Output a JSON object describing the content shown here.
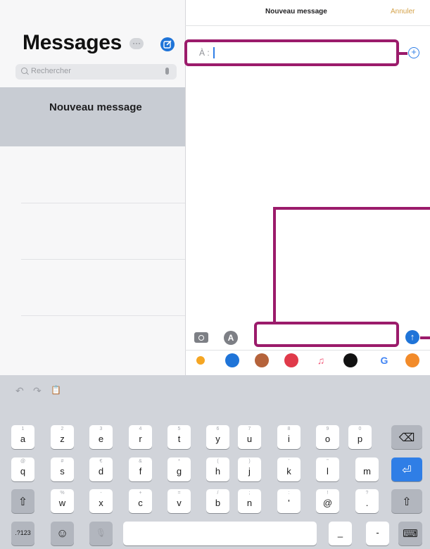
{
  "sidebar": {
    "title": "Messages",
    "more_label": "···",
    "search_placeholder": "Rechercher",
    "selected_conversation": "Nouveau message"
  },
  "header": {
    "title": "Nouveau message",
    "cancel_label": "Annuler"
  },
  "recipient": {
    "label": "À :",
    "add_label": "+"
  },
  "composer": {
    "send_label": "↑",
    "appstore_label": "A",
    "camera_icon": "camera-icon"
  },
  "app_drawer": {
    "apps": [
      {
        "name": "photos-app-icon",
        "color": "#f5a623"
      },
      {
        "name": "appstore-app-icon",
        "color": "#1f74d8"
      },
      {
        "name": "memoji-app-icon",
        "color": "#b5633b"
      },
      {
        "name": "images-search-app-icon",
        "color": "#e03a4a"
      },
      {
        "name": "music-app-icon",
        "color": "#f25a7a"
      },
      {
        "name": "digital-touch-app-icon",
        "color": "#111111"
      },
      {
        "name": "google-app-icon",
        "color": "#4285f4"
      },
      {
        "name": "animoji-app-icon",
        "color": "#f28b2a"
      }
    ],
    "music_glyph": "♫",
    "google_glyph": "G"
  },
  "keyboard": {
    "row1": [
      {
        "hint": "1",
        "label": "a"
      },
      {
        "hint": "2",
        "label": "z"
      },
      {
        "hint": "3",
        "label": "e"
      },
      {
        "hint": "4",
        "label": "r"
      },
      {
        "hint": "5",
        "label": "t"
      },
      {
        "hint": "6",
        "label": "y"
      },
      {
        "hint": "7",
        "label": "u"
      },
      {
        "hint": "8",
        "label": "i"
      },
      {
        "hint": "9",
        "label": "o"
      },
      {
        "hint": "0",
        "label": "p"
      }
    ],
    "row2": [
      {
        "hint": "@",
        "label": "q"
      },
      {
        "hint": "#",
        "label": "s"
      },
      {
        "hint": "€",
        "label": "d"
      },
      {
        "hint": "&",
        "label": "f"
      },
      {
        "hint": "*",
        "label": "g"
      },
      {
        "hint": "(",
        "label": "h"
      },
      {
        "hint": ")",
        "label": "j"
      },
      {
        "hint": "'",
        "label": "k"
      },
      {
        "hint": "\"",
        "label": "l"
      },
      {
        "hint": "",
        "label": "m"
      }
    ],
    "row3": [
      {
        "hint": "%",
        "label": "w"
      },
      {
        "hint": "-",
        "label": "x"
      },
      {
        "hint": "+",
        "label": "c"
      },
      {
        "hint": "=",
        "label": "v"
      },
      {
        "hint": "/",
        "label": "b"
      },
      {
        "hint": ";",
        "label": "n"
      },
      {
        "hint": ":",
        "label": "'"
      },
      {
        "hint": "!",
        "label": "@"
      },
      {
        "hint": "?",
        "label": "."
      }
    ],
    "delete_label": "⌫",
    "return_label": "⏎",
    "shift_label": "⇧",
    "numbers_label": ".?123",
    "emoji_label": "☺",
    "mic_label": "🎙",
    "underscore_label": "_",
    "dash_label": "-",
    "hide_label": "⌨",
    "undo_label": "↶",
    "redo_label": "↷",
    "paste_label": "📋"
  }
}
